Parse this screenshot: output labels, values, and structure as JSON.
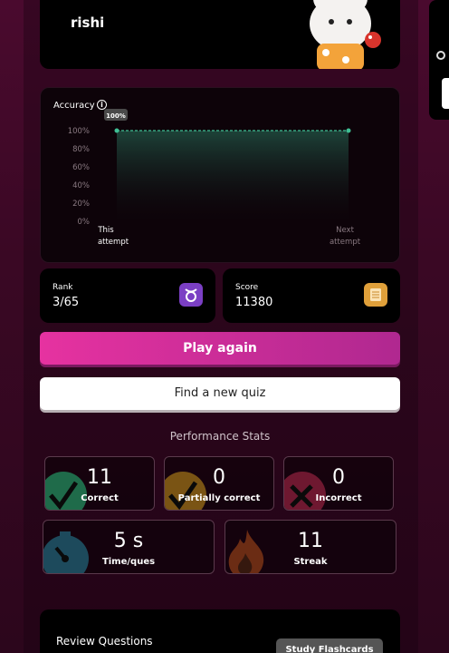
{
  "profile": {
    "name": "rishi"
  },
  "accuracy": {
    "title": "Accuracy",
    "tooltip": "100%",
    "y_ticks": [
      "100%",
      "80%",
      "60%",
      "40%",
      "20%",
      "0%"
    ],
    "x_left_line1": "This",
    "x_left_line2": "attempt",
    "x_right_line1": "Next",
    "x_right_line2": "attempt"
  },
  "chart_data": {
    "type": "area",
    "title": "Accuracy",
    "categories": [
      "This attempt",
      "Next attempt"
    ],
    "values": [
      100,
      100
    ],
    "ylim": [
      0,
      100
    ],
    "y_ticks": [
      0,
      20,
      40,
      60,
      80,
      100
    ],
    "data_labels": [
      "100%"
    ]
  },
  "rank": {
    "label": "Rank",
    "value": "3/65",
    "icon": "taurus-icon"
  },
  "score": {
    "label": "Score",
    "value": "11380",
    "icon": "document-icon"
  },
  "actions": {
    "play_again": "Play again",
    "find_quiz": "Find a new quiz"
  },
  "performance": {
    "title": "Performance Stats",
    "correct": {
      "value": "11",
      "label": "Correct",
      "color": "#1f6b4a"
    },
    "partial": {
      "value": "0",
      "label": "Partially correct",
      "color": "#7a5414"
    },
    "incorrect": {
      "value": "0",
      "label": "Incorrect",
      "color": "#6e1830"
    },
    "time": {
      "value": "5 s",
      "label": "Time/ques",
      "color": "#1d4a5c"
    },
    "streak": {
      "value": "11",
      "label": "Streak",
      "color": "#6b2c14"
    }
  },
  "review": {
    "title": "Review Questions",
    "flashcards": "Study Flashcards"
  }
}
